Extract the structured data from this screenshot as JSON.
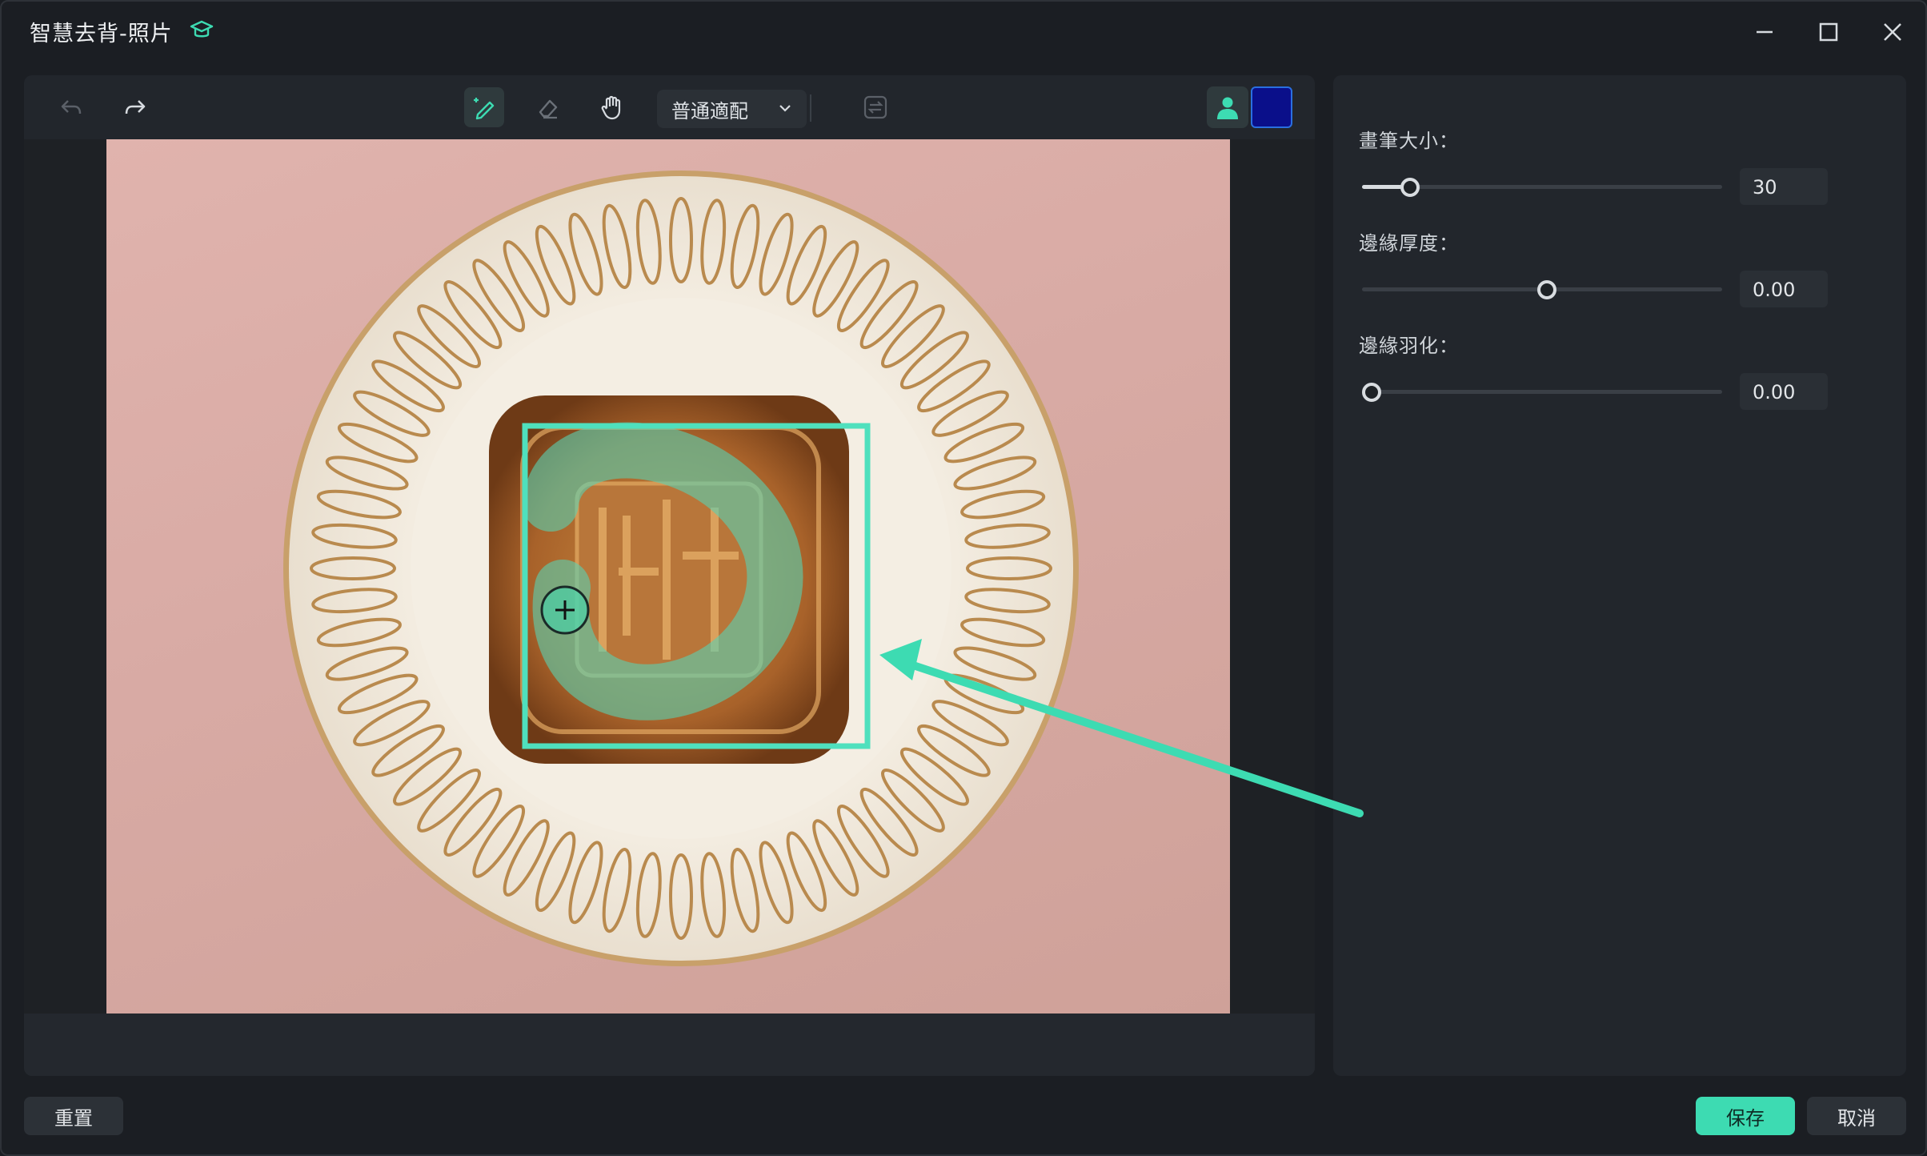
{
  "window": {
    "title": "智慧去背-照片",
    "icons": [
      "graduation-cap-icon",
      "minimize-icon",
      "maximize-icon",
      "close-icon"
    ]
  },
  "toolbar": {
    "icons": [
      "undo-icon",
      "redo-icon",
      "smart-brush-icon",
      "eraser-icon",
      "hand-icon",
      "swap-icon",
      "person-icon"
    ],
    "mode_select": "普通適配",
    "active_tool": "smart-brush",
    "background_color": "#0a0f8a"
  },
  "settings": {
    "brush_size": {
      "label": "畫筆大小：",
      "value": "30",
      "level": 0.11
    },
    "edge_thickness": {
      "label": "邊緣厚度：",
      "value": "0.00",
      "level": 0.5
    },
    "edge_feather": {
      "label": "邊緣羽化：",
      "value": "0.00",
      "level": 0.0
    }
  },
  "footer": {
    "reset": "重置",
    "save": "保存",
    "cancel": "取消"
  },
  "colors": {
    "accent": "#3ddbb2",
    "window_bg": "#1b1e23",
    "panel_bg": "#22262c"
  }
}
